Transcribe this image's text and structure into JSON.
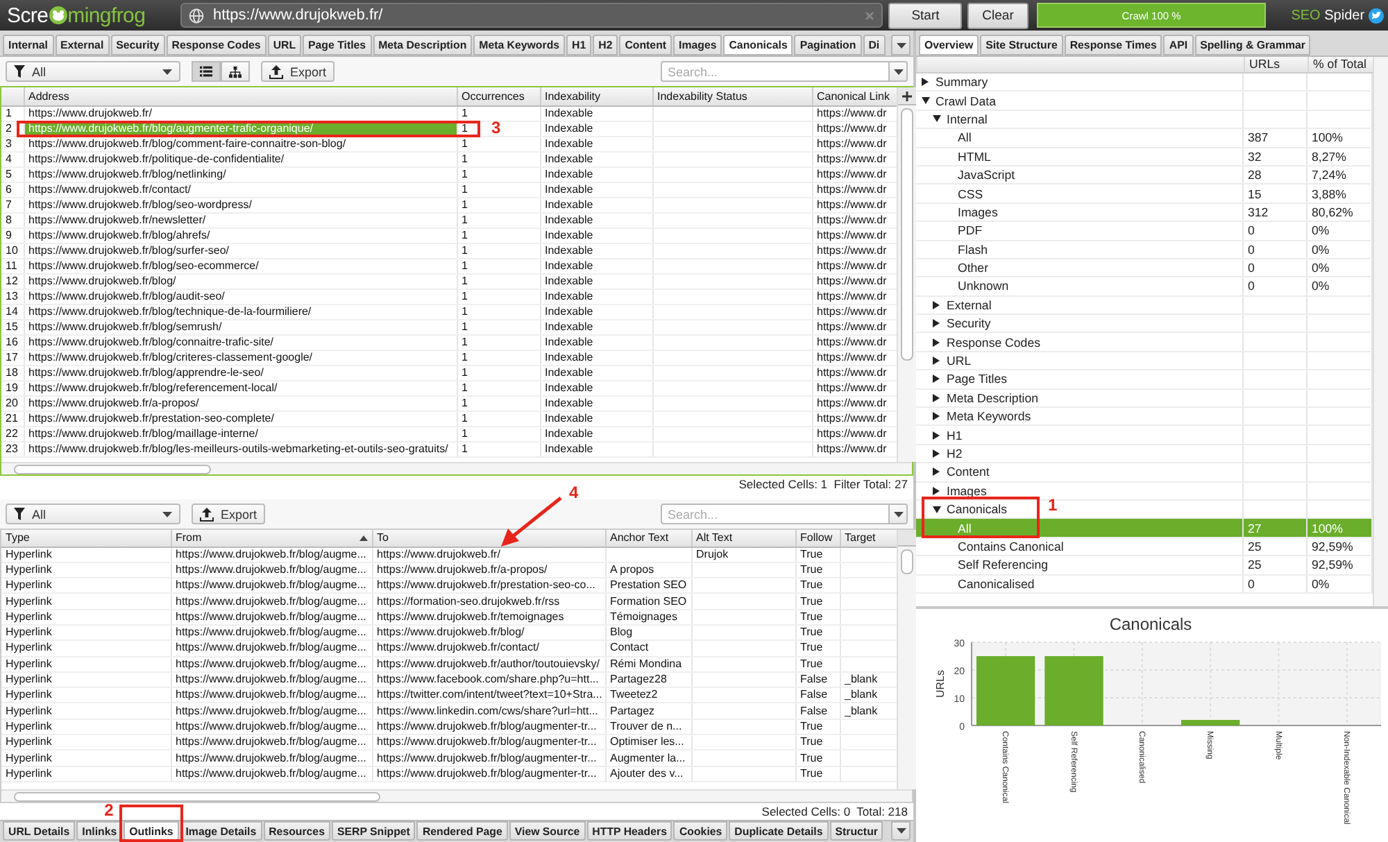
{
  "app": {
    "logo": {
      "before": "Scre",
      "after": "mingfrog"
    },
    "url": "https://www.drujokweb.fr/",
    "buttons": [
      "Start",
      "Clear"
    ],
    "progress": {
      "label": "Crawl 100 %",
      "level": 1
    },
    "product": [
      "SEO",
      "Spider"
    ]
  },
  "main_tabs": [
    {
      "label": "Internal",
      "selected": false
    },
    {
      "label": "External",
      "selected": false
    },
    {
      "label": "Security",
      "selected": false
    },
    {
      "label": "Response Codes",
      "selected": false
    },
    {
      "label": "URL",
      "selected": false
    },
    {
      "label": "Page Titles",
      "selected": false
    },
    {
      "label": "Meta Description",
      "selected": false
    },
    {
      "label": "Meta Keywords",
      "selected": false
    },
    {
      "label": "H1",
      "selected": false
    },
    {
      "label": "H2",
      "selected": false
    },
    {
      "label": "Content",
      "selected": false
    },
    {
      "label": "Images",
      "selected": false
    },
    {
      "label": "Canonicals",
      "selected": true
    },
    {
      "label": "Pagination",
      "selected": false
    },
    {
      "label": "Di",
      "selected": false
    }
  ],
  "top_toolbar": {
    "filter": "All",
    "view_modes": [
      {
        "kind": "list",
        "selected": true
      },
      {
        "kind": "tree",
        "selected": false
      }
    ],
    "export": "Export",
    "search": {
      "placeholder": "Search..."
    }
  },
  "top_table": {
    "columns": [
      "Address",
      "Occurrences",
      "Indexability",
      "Indexability Status",
      "Canonical Link"
    ],
    "rows": [
      {
        "number": "1",
        "address": "https://www.drujokweb.fr/",
        "occurrences": "1",
        "indexability": "Indexable",
        "canonical_link": "https://www.dr",
        "selected": false
      },
      {
        "number": "2",
        "address": "https://www.drujokweb.fr/blog/augmenter-trafic-organique/",
        "occurrences": "1",
        "indexability": "Indexable",
        "canonical_link": "https://www.dr",
        "selected": true
      },
      {
        "number": "3",
        "address": "https://www.drujokweb.fr/blog/comment-faire-connaitre-son-blog/",
        "occurrences": "1",
        "indexability": "Indexable",
        "canonical_link": "https://www.dr",
        "selected": false
      },
      {
        "number": "4",
        "address": "https://www.drujokweb.fr/politique-de-confidentialite/",
        "occurrences": "1",
        "indexability": "Indexable",
        "canonical_link": "https://www.dr",
        "selected": false
      },
      {
        "number": "5",
        "address": "https://www.drujokweb.fr/blog/netlinking/",
        "occurrences": "1",
        "indexability": "Indexable",
        "canonical_link": "https://www.dr",
        "selected": false
      },
      {
        "number": "6",
        "address": "https://www.drujokweb.fr/contact/",
        "occurrences": "1",
        "indexability": "Indexable",
        "canonical_link": "https://www.dr",
        "selected": false
      },
      {
        "number": "7",
        "address": "https://www.drujokweb.fr/blog/seo-wordpress/",
        "occurrences": "1",
        "indexability": "Indexable",
        "canonical_link": "https://www.dr",
        "selected": false
      },
      {
        "number": "8",
        "address": "https://www.drujokweb.fr/newsletter/",
        "occurrences": "1",
        "indexability": "Indexable",
        "canonical_link": "https://www.dr",
        "selected": false
      },
      {
        "number": "9",
        "address": "https://www.drujokweb.fr/blog/ahrefs/",
        "occurrences": "1",
        "indexability": "Indexable",
        "canonical_link": "https://www.dr",
        "selected": false
      },
      {
        "number": "10",
        "address": "https://www.drujokweb.fr/blog/surfer-seo/",
        "occurrences": "1",
        "indexability": "Indexable",
        "canonical_link": "https://www.dr",
        "selected": false
      },
      {
        "number": "11",
        "address": "https://www.drujokweb.fr/blog/seo-ecommerce/",
        "occurrences": "1",
        "indexability": "Indexable",
        "canonical_link": "https://www.dr",
        "selected": false
      },
      {
        "number": "12",
        "address": "https://www.drujokweb.fr/blog/",
        "occurrences": "1",
        "indexability": "Indexable",
        "canonical_link": "https://www.dr",
        "selected": false
      },
      {
        "number": "13",
        "address": "https://www.drujokweb.fr/blog/audit-seo/",
        "occurrences": "1",
        "indexability": "Indexable",
        "canonical_link": "https://www.dr",
        "selected": false
      },
      {
        "number": "14",
        "address": "https://www.drujokweb.fr/blog/technique-de-la-fourmiliere/",
        "occurrences": "1",
        "indexability": "Indexable",
        "canonical_link": "https://www.dr",
        "selected": false
      },
      {
        "number": "15",
        "address": "https://www.drujokweb.fr/blog/semrush/",
        "occurrences": "1",
        "indexability": "Indexable",
        "canonical_link": "https://www.dr",
        "selected": false
      },
      {
        "number": "16",
        "address": "https://www.drujokweb.fr/blog/connaitre-trafic-site/",
        "occurrences": "1",
        "indexability": "Indexable",
        "canonical_link": "https://www.dr",
        "selected": false
      },
      {
        "number": "17",
        "address": "https://www.drujokweb.fr/blog/criteres-classement-google/",
        "occurrences": "1",
        "indexability": "Indexable",
        "canonical_link": "https://www.dr",
        "selected": false
      },
      {
        "number": "18",
        "address": "https://www.drujokweb.fr/blog/apprendre-le-seo/",
        "occurrences": "1",
        "indexability": "Indexable",
        "canonical_link": "https://www.dr",
        "selected": false
      },
      {
        "number": "19",
        "address": "https://www.drujokweb.fr/blog/referencement-local/",
        "occurrences": "1",
        "indexability": "Indexable",
        "canonical_link": "https://www.dr",
        "selected": false
      },
      {
        "number": "20",
        "address": "https://www.drujokweb.fr/a-propos/",
        "occurrences": "1",
        "indexability": "Indexable",
        "canonical_link": "https://www.dr",
        "selected": false
      },
      {
        "number": "21",
        "address": "https://www.drujokweb.fr/prestation-seo-complete/",
        "occurrences": "1",
        "indexability": "Indexable",
        "canonical_link": "https://www.dr",
        "selected": false
      },
      {
        "number": "22",
        "address": "https://www.drujokweb.fr/blog/maillage-interne/",
        "occurrences": "1",
        "indexability": "Indexable",
        "canonical_link": "https://www.dr",
        "selected": false
      },
      {
        "number": "23",
        "address": "https://www.drujokweb.fr/blog/les-meilleurs-outils-webmarketing-et-outils-seo-gratuits/",
        "occurrences": "1",
        "indexability": "Indexable",
        "canonical_link": "https://www.dr",
        "selected": false
      }
    ]
  },
  "top_status": "Selected Cells: 1  Filter Total: 27",
  "bottom_toolbar": {
    "filter": "All",
    "export": "Export",
    "search": {
      "placeholder": "Search..."
    }
  },
  "bottom_table": {
    "columns": [
      {
        "label": "Type",
        "sorted": false
      },
      {
        "label": "From",
        "sorted": true
      },
      {
        "label": "To",
        "sorted": false
      },
      {
        "label": "Anchor Text",
        "sorted": false
      },
      {
        "label": "Alt Text",
        "sorted": false
      },
      {
        "label": "Follow",
        "sorted": false
      },
      {
        "label": "Target",
        "sorted": false
      }
    ],
    "rows": [
      {
        "type": "Hyperlink",
        "from": "https://www.drujokweb.fr/blog/augme...",
        "to": "https://www.drujokweb.fr/",
        "alt_text": "Drujok",
        "follow": "True"
      },
      {
        "type": "Hyperlink",
        "from": "https://www.drujokweb.fr/blog/augme...",
        "to": "https://www.drujokweb.fr/a-propos/",
        "anchor_text": "A propos",
        "follow": "True"
      },
      {
        "type": "Hyperlink",
        "from": "https://www.drujokweb.fr/blog/augme...",
        "to": "https://www.drujokweb.fr/prestation-seo-co...",
        "anchor_text": "Prestation SEO",
        "follow": "True"
      },
      {
        "type": "Hyperlink",
        "from": "https://www.drujokweb.fr/blog/augme...",
        "to": "https://formation-seo.drujokweb.fr/rss",
        "anchor_text": "Formation SEO",
        "follow": "True"
      },
      {
        "type": "Hyperlink",
        "from": "https://www.drujokweb.fr/blog/augme...",
        "to": "https://www.drujokweb.fr/temoignages",
        "anchor_text": "Témoignages",
        "follow": "True"
      },
      {
        "type": "Hyperlink",
        "from": "https://www.drujokweb.fr/blog/augme...",
        "to": "https://www.drujokweb.fr/blog/",
        "anchor_text": "Blog",
        "follow": "True"
      },
      {
        "type": "Hyperlink",
        "from": "https://www.drujokweb.fr/blog/augme...",
        "to": "https://www.drujokweb.fr/contact/",
        "anchor_text": "Contact",
        "follow": "True"
      },
      {
        "type": "Hyperlink",
        "from": "https://www.drujokweb.fr/blog/augme...",
        "to": "https://www.drujokweb.fr/author/toutouievsky/",
        "anchor_text": "Rémi Mondina",
        "follow": "True"
      },
      {
        "type": "Hyperlink",
        "from": "https://www.drujokweb.fr/blog/augme...",
        "to": "https://www.facebook.com/share.php?u=htt...",
        "anchor_text": "Partagez28",
        "follow": "False",
        "target": "_blank"
      },
      {
        "type": "Hyperlink",
        "from": "https://www.drujokweb.fr/blog/augme...",
        "to": "https://twitter.com/intent/tweet?text=10+Stra...",
        "anchor_text": "Tweetez2",
        "follow": "False",
        "target": "_blank"
      },
      {
        "type": "Hyperlink",
        "from": "https://www.drujokweb.fr/blog/augme...",
        "to": "https://www.linkedin.com/cws/share?url=htt...",
        "anchor_text": "Partagez",
        "follow": "False",
        "target": "_blank"
      },
      {
        "type": "Hyperlink",
        "from": "https://www.drujokweb.fr/blog/augme...",
        "to": "https://www.drujokweb.fr/blog/augmenter-tr...",
        "anchor_text": "Trouver de n...",
        "follow": "True"
      },
      {
        "type": "Hyperlink",
        "from": "https://www.drujokweb.fr/blog/augme...",
        "to": "https://www.drujokweb.fr/blog/augmenter-tr...",
        "anchor_text": "Optimiser les...",
        "follow": "True"
      },
      {
        "type": "Hyperlink",
        "from": "https://www.drujokweb.fr/blog/augme...",
        "to": "https://www.drujokweb.fr/blog/augmenter-tr...",
        "anchor_text": "Augmenter la...",
        "follow": "True"
      },
      {
        "type": "Hyperlink",
        "from": "https://www.drujokweb.fr/blog/augme...",
        "to": "https://www.drujokweb.fr/blog/augmenter-tr...",
        "anchor_text": "Ajouter des v...",
        "follow": "True"
      }
    ]
  },
  "bottom_status": "Selected Cells: 0  Total: 218",
  "detail_tabs": [
    {
      "label": "URL Details",
      "selected": false
    },
    {
      "label": "Inlinks",
      "selected": false
    },
    {
      "label": "Outlinks",
      "selected": true
    },
    {
      "label": "Image Details",
      "selected": false
    },
    {
      "label": "Resources",
      "selected": false
    },
    {
      "label": "SERP Snippet",
      "selected": false
    },
    {
      "label": "Rendered Page",
      "selected": false
    },
    {
      "label": "View Source",
      "selected": false
    },
    {
      "label": "HTTP Headers",
      "selected": false
    },
    {
      "label": "Cookies",
      "selected": false
    },
    {
      "label": "Duplicate Details",
      "selected": false
    },
    {
      "label": "Structur",
      "selected": false
    }
  ],
  "side_tabs": [
    {
      "label": "Overview",
      "selected": true
    },
    {
      "label": "Site Structure",
      "selected": false
    },
    {
      "label": "Response Times",
      "selected": false
    },
    {
      "label": "API",
      "selected": false
    },
    {
      "label": "Spelling & Grammar",
      "selected": false
    }
  ],
  "overview": {
    "columns": [
      "URLs",
      "% of Total"
    ],
    "items": [
      {
        "label": "Summary",
        "expanded": false,
        "selected": false
      },
      {
        "label": "Crawl Data",
        "expanded": true,
        "selected": false,
        "children": [
          {
            "label": "Internal",
            "expanded": true,
            "selected": false,
            "children": [
              {
                "label": "All",
                "urls": "387",
                "percent": "100%",
                "selected": false
              },
              {
                "label": "HTML",
                "urls": "32",
                "percent": "8,27%",
                "selected": false
              },
              {
                "label": "JavaScript",
                "urls": "28",
                "percent": "7,24%",
                "selected": false
              },
              {
                "label": "CSS",
                "urls": "15",
                "percent": "3,88%",
                "selected": false
              },
              {
                "label": "Images",
                "urls": "312",
                "percent": "80,62%",
                "selected": false
              },
              {
                "label": "PDF",
                "urls": "0",
                "percent": "0%",
                "selected": false
              },
              {
                "label": "Flash",
                "urls": "0",
                "percent": "0%",
                "selected": false
              },
              {
                "label": "Other",
                "urls": "0",
                "percent": "0%",
                "selected": false
              },
              {
                "label": "Unknown",
                "urls": "0",
                "percent": "0%",
                "selected": false
              }
            ]
          },
          {
            "label": "External",
            "expanded": false,
            "selected": false
          },
          {
            "label": "Security",
            "expanded": false,
            "selected": false
          },
          {
            "label": "Response Codes",
            "expanded": false,
            "selected": false
          },
          {
            "label": "URL",
            "expanded": false,
            "selected": false
          },
          {
            "label": "Page Titles",
            "expanded": false,
            "selected": false
          },
          {
            "label": "Meta Description",
            "expanded": false,
            "selected": false
          },
          {
            "label": "Meta Keywords",
            "expanded": false,
            "selected": false
          },
          {
            "label": "H1",
            "expanded": false,
            "selected": false
          },
          {
            "label": "H2",
            "expanded": false,
            "selected": false
          },
          {
            "label": "Content",
            "expanded": false,
            "selected": false
          },
          {
            "label": "Images",
            "expanded": false,
            "selected": false
          },
          {
            "label": "Canonicals",
            "expanded": true,
            "selected": false,
            "children": [
              {
                "label": "All",
                "urls": "27",
                "percent": "100%",
                "selected": true
              },
              {
                "label": "Contains Canonical",
                "urls": "25",
                "percent": "92,59%",
                "selected": false
              },
              {
                "label": "Self Referencing",
                "urls": "25",
                "percent": "92,59%",
                "selected": false
              },
              {
                "label": "Canonicalised",
                "urls": "0",
                "percent": "0%",
                "selected": false
              }
            ]
          }
        ]
      }
    ]
  },
  "chart_panel": {
    "chart_data": {
      "type": "bar",
      "title": "Canonicals",
      "ylabel": "URLs",
      "categories": [
        "Contains Canonical",
        "Self Referencing",
        "Canonicalised",
        "Missing",
        "Multiple",
        "Non-Indexable Canonical"
      ],
      "values": [
        25,
        25,
        0,
        2,
        0,
        0
      ],
      "ylim": [
        0,
        30
      ],
      "yticks": [
        0,
        10,
        20,
        30
      ],
      "grid": true
    }
  },
  "annotations": [
    {
      "kind": "box",
      "label": "3"
    },
    {
      "kind": "arrow",
      "label": "4"
    },
    {
      "kind": "box",
      "label": "1"
    },
    {
      "kind": "box",
      "label": "2"
    }
  ]
}
